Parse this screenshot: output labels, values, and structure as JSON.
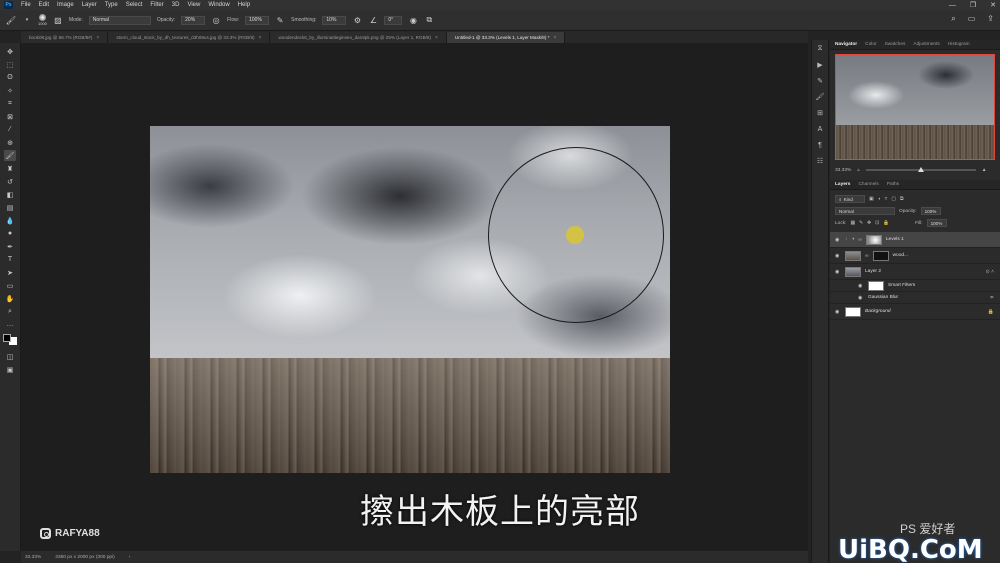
{
  "menu": {
    "logo": "Ps",
    "items": [
      "File",
      "Edit",
      "Image",
      "Layer",
      "Type",
      "Select",
      "Filter",
      "3D",
      "View",
      "Window",
      "Help"
    ]
  },
  "options_bar": {
    "brush_size": "1000",
    "mode_label": "Mode:",
    "mode_value": "Normal",
    "opacity_label": "Opacity:",
    "opacity_value": "20%",
    "flow_label": "Flow:",
    "flow_value": "100%",
    "smoothing_label": "Smoothing:",
    "smoothing_value": "10%",
    "angle_value": "0°"
  },
  "tabs": [
    {
      "label": "book08.jpg @ 66.7% (RGB/8#)",
      "active": false
    },
    {
      "label": "storm_cloud_stock_by_dh_textures_d3h08us.jpg @ 33.3% (RGB/8)",
      "active": false
    },
    {
      "label": "woodendeck6_by_illuminatiteginseo_da19pk.png @ 25% (Layer 1, RGB/8)",
      "active": false
    },
    {
      "label": "Untitled-1 @ 33.3% (Levels 1, Layer Mask/8) *",
      "active": true
    }
  ],
  "canvas": {
    "subtitle": "擦出木板上的亮部",
    "watermark_left": "RAFYA88"
  },
  "status_bar": {
    "zoom": "33.33%",
    "doc_info": "3360 px x 2000 px (300 ppi)"
  },
  "navigator": {
    "tabs": [
      "Navigator",
      "Color",
      "Swatches",
      "Adjustments",
      "Histogram"
    ],
    "zoom": "33.33%"
  },
  "layers_panel": {
    "tabs": [
      "Layers",
      "Channels",
      "Paths"
    ],
    "filter_kind": "Kind",
    "blend_mode": "Normal",
    "opacity_label": "Opacity:",
    "opacity_value": "100%",
    "lock_label": "Lock:",
    "fill_label": "Fill:",
    "fill_value": "100%",
    "layers": [
      {
        "name": "Levels 1",
        "selected": true
      },
      {
        "name": "wood...",
        "selected": false
      },
      {
        "name": "Layer 2",
        "selected": false
      },
      {
        "name": "Smart Filters",
        "selected": false
      },
      {
        "name": "Gaussian Blur",
        "selected": false
      },
      {
        "name": "Background",
        "selected": false
      }
    ]
  },
  "watermark_right": "UiBQ.CoM",
  "watermark_ps": "PS 爱好者"
}
